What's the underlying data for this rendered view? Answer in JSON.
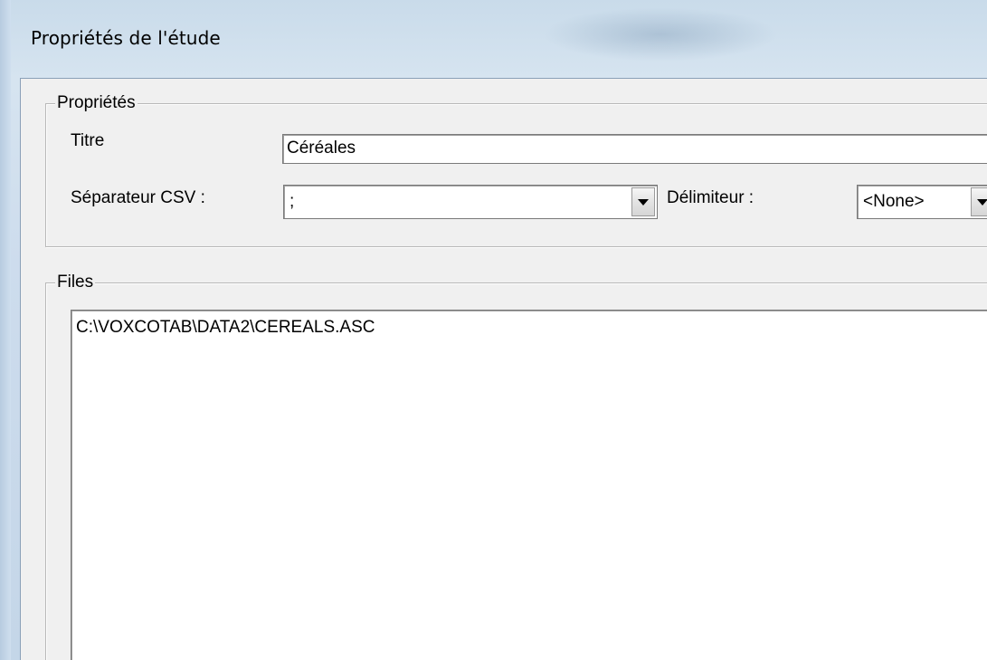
{
  "window": {
    "title": "Propriétés de l'étude"
  },
  "properties_group": {
    "legend": "Propriétés",
    "title_label": "Titre",
    "title_value": "Céréales",
    "csv_separator_label": "Séparateur CSV :",
    "csv_separator_value": ";",
    "delimiter_label": "Délimiteur :",
    "delimiter_value": "<None>"
  },
  "files_group": {
    "legend": "Files",
    "items": [
      "C:\\VOXCOTAB\\DATA2\\CEREALS.ASC"
    ]
  },
  "icons": {
    "combo_arrow": "chevron-down-icon"
  }
}
